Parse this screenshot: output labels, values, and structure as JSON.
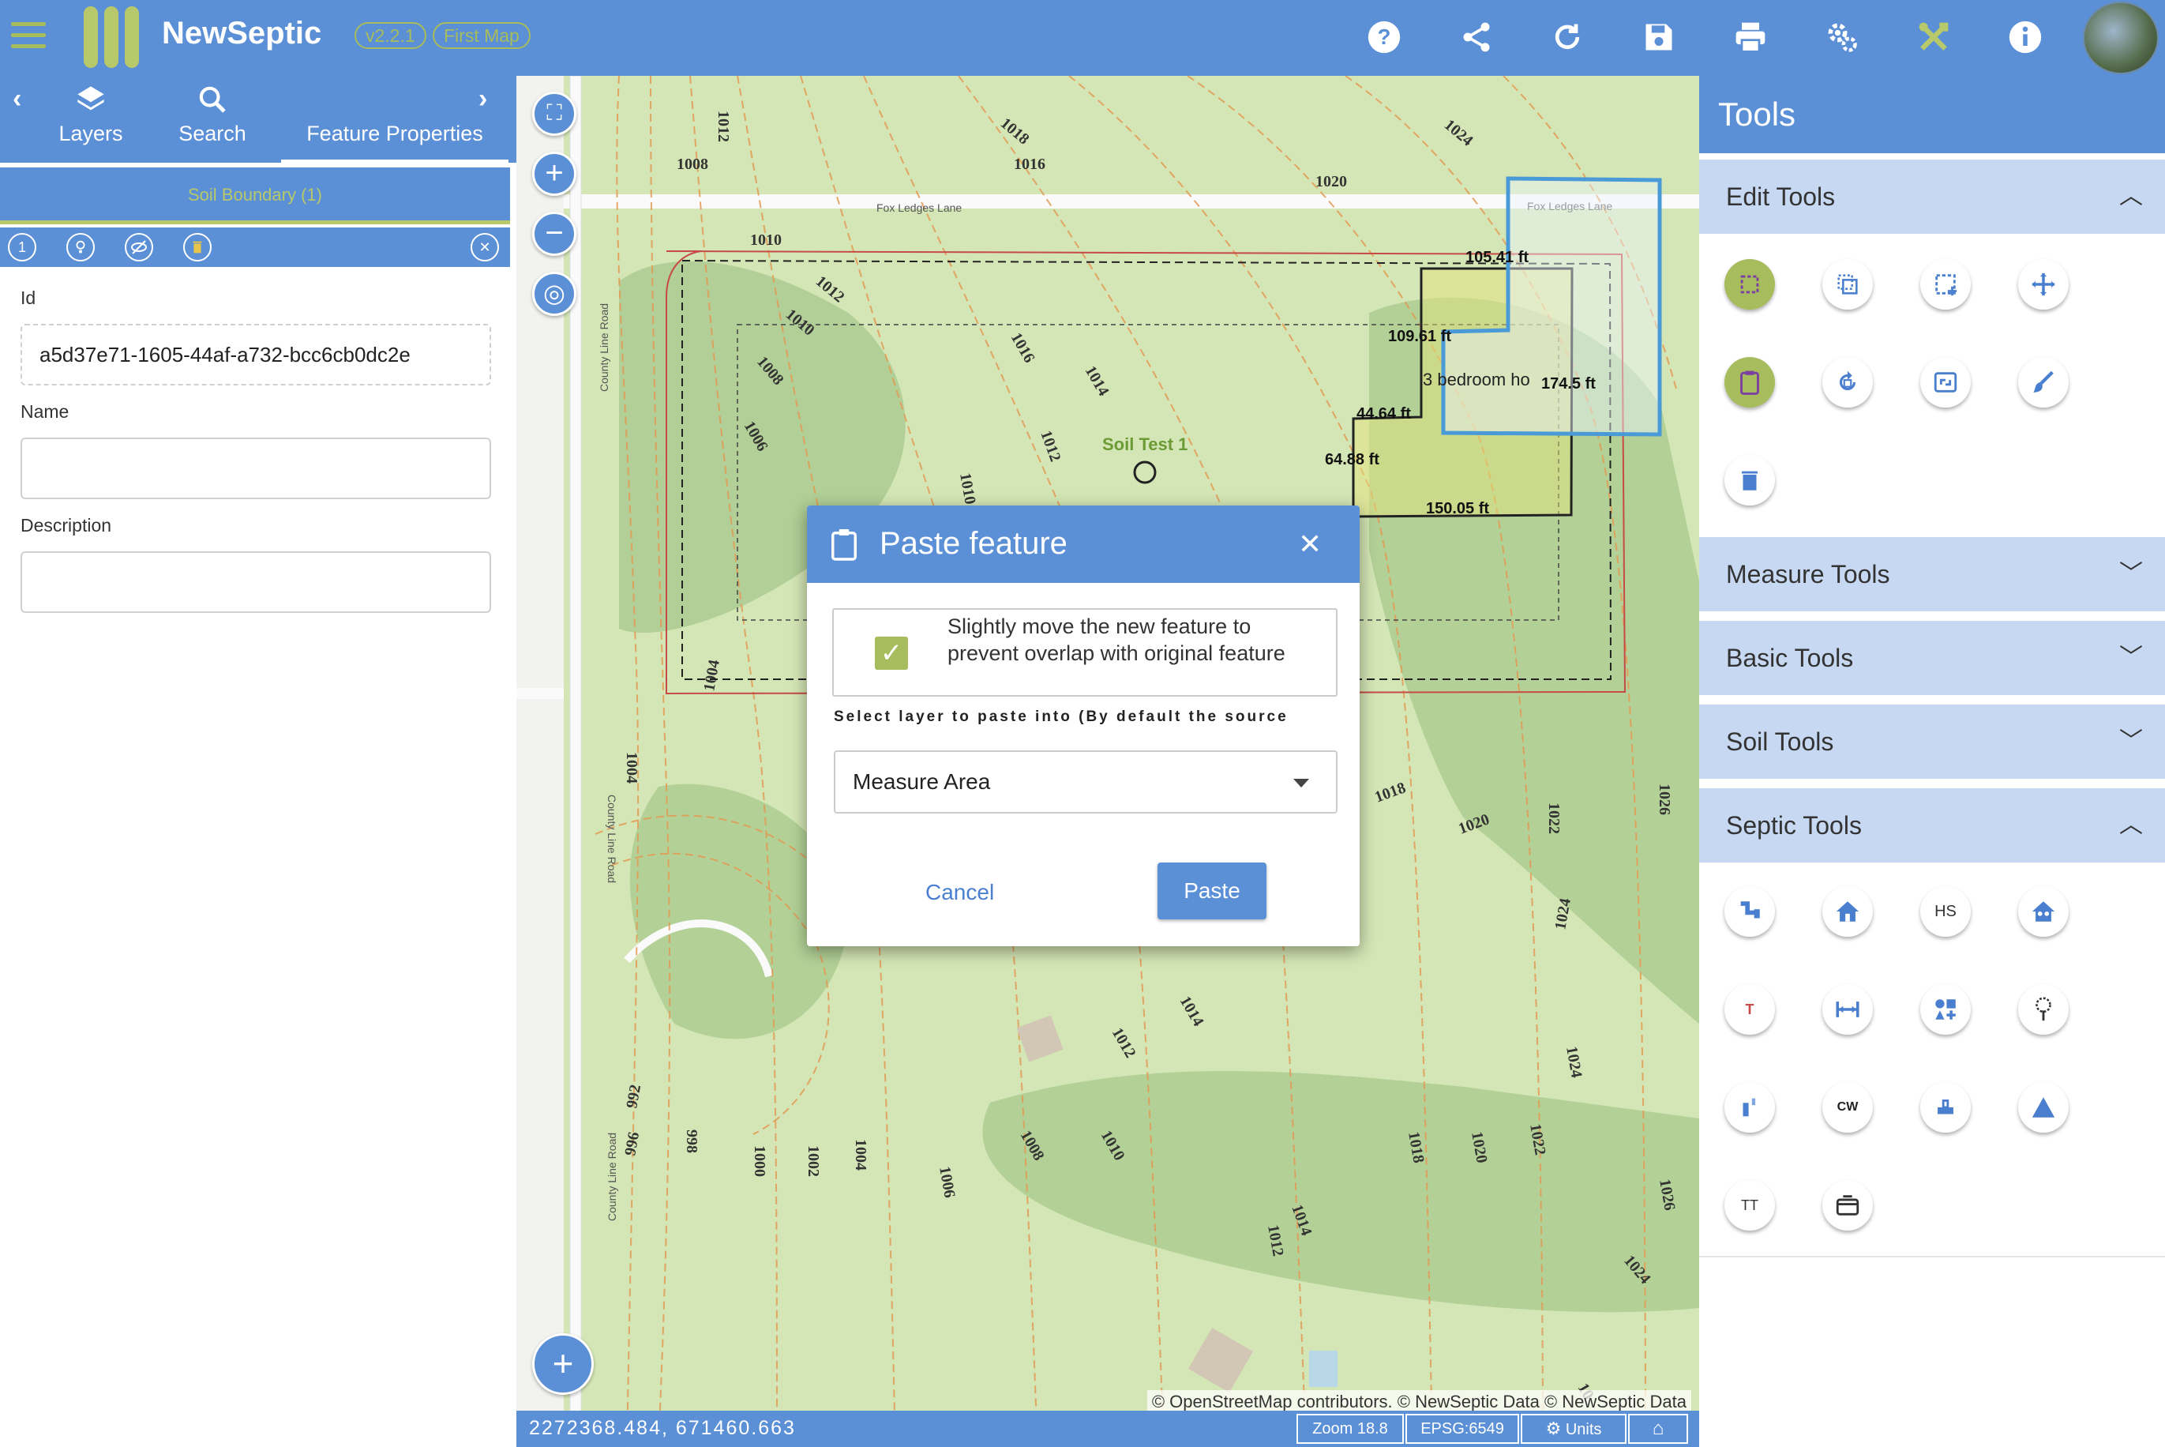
{
  "header": {
    "app_title": "NewSeptic",
    "version": "v2.2.1",
    "map_name": "First Map",
    "icons": [
      "help-icon",
      "share-icon",
      "refresh-icon",
      "save-icon",
      "print-icon",
      "settings-icon",
      "tools-icon",
      "info-icon"
    ],
    "accent_color": "#5b8fd6",
    "brand_green": "#a7bc5c"
  },
  "left_panel": {
    "tabs": [
      {
        "label": "Layers",
        "icon": "layers-icon"
      },
      {
        "label": "Search",
        "icon": "search-icon"
      },
      {
        "label": "Feature Properties",
        "icon": "",
        "active": true
      }
    ],
    "feature_header": "Soil Boundary (1)",
    "feature_index": "1",
    "fields": {
      "id_label": "Id",
      "id_value": "a5d37e71-1605-44af-a732-bcc6cb0dc2e",
      "name_label": "Name",
      "name_value": "",
      "description_label": "Description",
      "description_value": ""
    }
  },
  "map": {
    "road_labels": [
      "Fox Ledges Lane",
      "Fox Ledges Lane",
      "County Line Road",
      "County Line Road",
      "County Line Road"
    ],
    "contour_labels": [
      "1008",
      "1016",
      "1018",
      "1012",
      "1020",
      "1024",
      "1010",
      "1012",
      "1010",
      "1016",
      "1008",
      "1014",
      "1006",
      "1012",
      "1010",
      "1004",
      "1004",
      "1018",
      "1020",
      "1022",
      "1026",
      "1024",
      "1012",
      "1014",
      "1024",
      "992",
      "996",
      "998",
      "1000",
      "1002",
      "1004",
      "1006",
      "1008",
      "1010",
      "1012",
      "1014",
      "1018",
      "1020",
      "1022",
      "1026",
      "1024",
      "10"
    ],
    "soil_test_label": "Soil Test 1",
    "house_label": "3 bedroom ho",
    "measurements": [
      "105.41 ft",
      "109.61 ft",
      "174.5 ft",
      "44.64 ft",
      "64.88 ft",
      "150.05 ft"
    ],
    "attribution": "© OpenStreetMap contributors. © NewSeptic Data © NewSeptic Data",
    "coordinates": "2272368.484, 671460.663",
    "zoom": "Zoom 18.8",
    "epsg": "EPSG:6549",
    "units": "Units"
  },
  "dialog": {
    "title": "Paste feature",
    "checkbox_label": "Slightly move the new feature to prevent overlap with original feature",
    "checkbox_checked": true,
    "select_label": "Select layer to paste into (By default the source",
    "select_value": "Measure Area",
    "cancel_label": "Cancel",
    "paste_label": "Paste"
  },
  "tools": {
    "title": "Tools",
    "sections": [
      {
        "label": "Edit Tools",
        "expanded": true
      },
      {
        "label": "Measure Tools",
        "expanded": false
      },
      {
        "label": "Basic Tools",
        "expanded": false
      },
      {
        "label": "Soil Tools",
        "expanded": false
      },
      {
        "label": "Septic Tools",
        "expanded": true
      }
    ],
    "edit_icons": [
      "select-box-icon",
      "copy-icon",
      "select-area-icon",
      "move-icon",
      "paste-icon",
      "rotate-icon",
      "resize-icon",
      "style-icon",
      "delete-icon"
    ],
    "septic_icons": [
      "pipe-icon",
      "house-icon",
      "hs-icon",
      "house-people-icon",
      "tank-icon",
      "distance-icon",
      "shapes-icon",
      "tree-icon",
      "well-icon",
      "cw-icon",
      "pump-icon",
      "triangle-icon",
      "text-icon",
      "box-icon"
    ],
    "septic_texts": {
      "hs": "HS",
      "t": "T",
      "cw": "CW",
      "tt": "TT"
    }
  }
}
